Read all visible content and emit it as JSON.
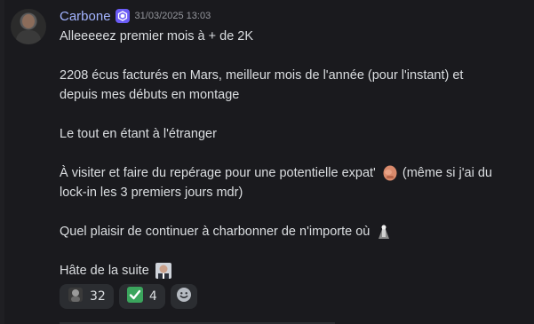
{
  "author": {
    "name": "Carbone",
    "timestamp": "31/03/2025 13:03"
  },
  "message": {
    "line1": "Alleeeeez premier mois à + de 2K",
    "line2": "2208 écus facturés en Mars, meilleur mois de l'année (pour l'instant) et",
    "line3": "depuis mes débuts en montage",
    "line4": "Le tout en étant à l'étranger",
    "line5a": "À visiter et faire du repérage pour une potentielle expat'",
    "line5b": "(même si j'ai du",
    "line6": "lock-in les 3 premiers jours mdr)",
    "line7": "Quel plaisir de continuer à charbonner de n'importe où",
    "line8": "Hâte de la suite"
  },
  "reactions": [
    {
      "emoji": "custom-face",
      "count": "32"
    },
    {
      "emoji": "check-mark",
      "count": "4"
    }
  ],
  "colors": {
    "background": "#1a1a1e",
    "username": "#a3b4ff",
    "reaction_bg": "#2b2d31",
    "check_green": "#3ba55d"
  }
}
